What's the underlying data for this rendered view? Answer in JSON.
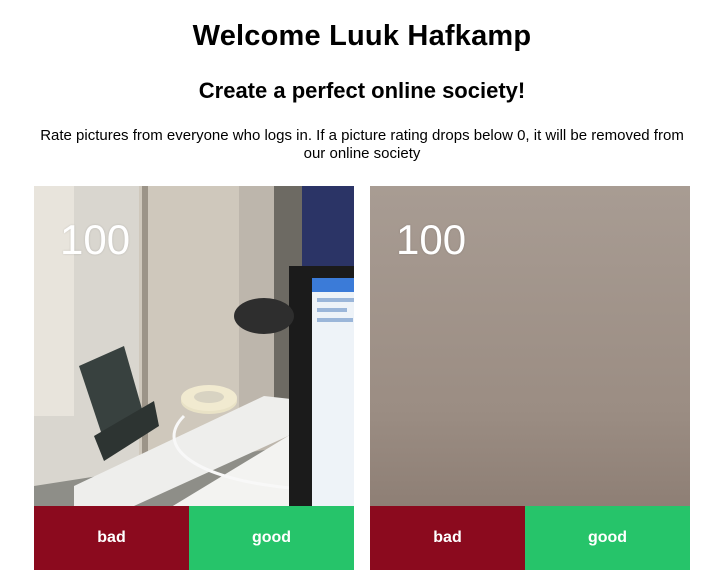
{
  "header": {
    "title": "Welcome Luuk Hafkamp",
    "subtitle": "Create a perfect online society!",
    "description": "Rate pictures from everyone who logs in. If a picture rating drops below 0, it will be removed from our online society"
  },
  "cards": [
    {
      "rating": "100",
      "bad_label": "bad",
      "good_label": "good"
    },
    {
      "rating": "100",
      "bad_label": "bad",
      "good_label": "good"
    }
  ],
  "colors": {
    "bad": "#8b0a1e",
    "good": "#26c46a"
  }
}
